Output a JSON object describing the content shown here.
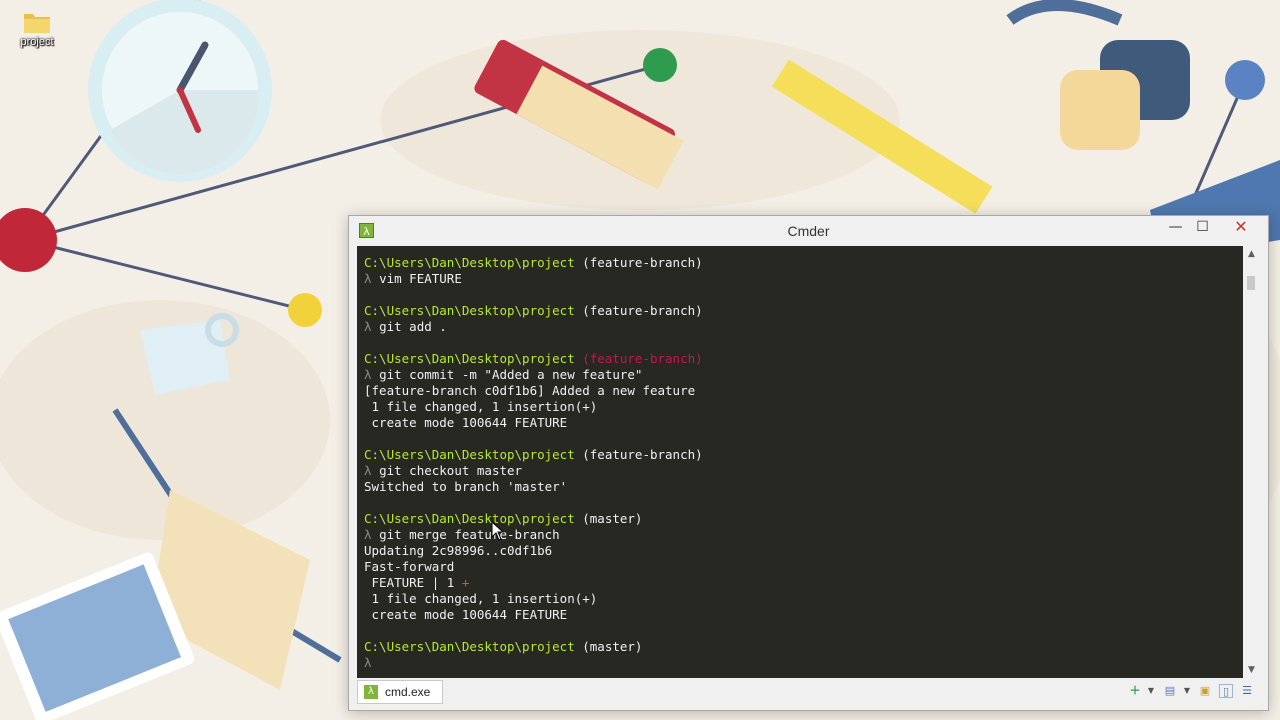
{
  "desktop": {
    "icons": [
      {
        "label": "project"
      }
    ]
  },
  "window": {
    "title": "Cmder",
    "buttons": {
      "minimize": "—",
      "maximize": "☐",
      "close": "✕"
    }
  },
  "console": {
    "prompt_symbol": "λ",
    "lines": [
      {
        "kind": "prompt",
        "path": "C:\\Users\\Dan\\Desktop\\project",
        "branch": "(feature-branch)"
      },
      {
        "kind": "cmd",
        "text": "vim FEATURE"
      },
      {
        "kind": "blank"
      },
      {
        "kind": "prompt",
        "path": "C:\\Users\\Dan\\Desktop\\project",
        "branch": "(feature-branch)"
      },
      {
        "kind": "cmd",
        "text": "git add ."
      },
      {
        "kind": "blank"
      },
      {
        "kind": "prompt",
        "path": "C:\\Users\\Dan\\Desktop\\project",
        "branch": "(feature-branch)",
        "dim": true
      },
      {
        "kind": "cmd",
        "text": "git commit -m \"Added a new feature\""
      },
      {
        "kind": "out",
        "text": "[feature-branch c0df1b6] Added a new feature"
      },
      {
        "kind": "out",
        "text": " 1 file changed, 1 insertion(+)"
      },
      {
        "kind": "out",
        "text": " create mode 100644 FEATURE"
      },
      {
        "kind": "blank"
      },
      {
        "kind": "prompt",
        "path": "C:\\Users\\Dan\\Desktop\\project",
        "branch": "(feature-branch)"
      },
      {
        "kind": "cmd",
        "text": "git checkout master"
      },
      {
        "kind": "out",
        "text": "Switched to branch 'master'"
      },
      {
        "kind": "blank"
      },
      {
        "kind": "prompt",
        "path": "C:\\Users\\Dan\\Desktop\\project",
        "branch": "(master)"
      },
      {
        "kind": "cmd",
        "text": "git merge feature-branch"
      },
      {
        "kind": "out",
        "text": "Updating 2c98996..c0df1b6"
      },
      {
        "kind": "out",
        "text": "Fast-forward"
      },
      {
        "kind": "diffstat",
        "text": " FEATURE | 1 ",
        "plus": "+"
      },
      {
        "kind": "out",
        "text": " 1 file changed, 1 insertion(+)"
      },
      {
        "kind": "out",
        "text": " create mode 100644 FEATURE"
      },
      {
        "kind": "blank"
      },
      {
        "kind": "prompt",
        "path": "C:\\Users\\Dan\\Desktop\\project",
        "branch": "(master)"
      },
      {
        "kind": "cmd",
        "text": ""
      }
    ]
  },
  "statusbar": {
    "tab_label": "cmd.exe",
    "tab_icon": "λ",
    "icons": [
      "add-console-icon",
      "dropdown-icon",
      "layout-icon",
      "dropdown-icon",
      "lock-icon",
      "split-icon",
      "menu-icon"
    ]
  },
  "colors": {
    "console_bg": "#272822",
    "path": "#b8e836",
    "branch_dim": "#c2184f",
    "accent": "#7fb53a",
    "close": "#c0392b"
  }
}
